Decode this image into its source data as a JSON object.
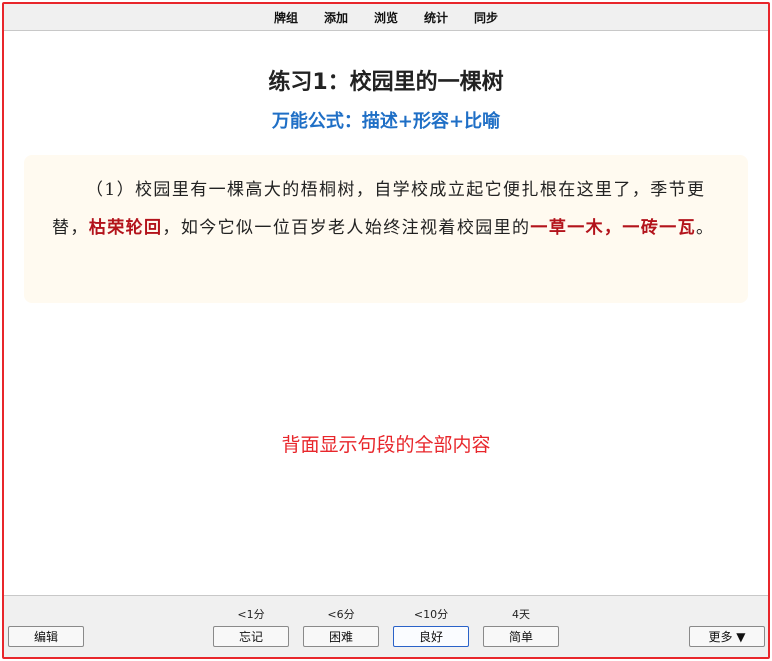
{
  "menu": {
    "decks": "牌组",
    "add": "添加",
    "browse": "浏览",
    "stats": "统计",
    "sync": "同步"
  },
  "card": {
    "title": "练习1：校园里的一棵树",
    "subtitle": "万能公式：描述+形容+比喻",
    "passage": {
      "p1": "（1）校园里有一棵高大的梧桐树，自学校成立起它便扎根在这里了，季节更替，",
      "h1": "枯荣轮回",
      "p2": "，如今它似一位百岁老人始终注视着校园里的",
      "h2": "一草一木，一砖一瓦",
      "p3": "。"
    },
    "note": "背面显示句段的全部内容"
  },
  "bottom": {
    "edit": "编辑",
    "more": "更多 ▼",
    "answers": [
      {
        "interval": "<1分",
        "label": "忘记"
      },
      {
        "interval": "<6分",
        "label": "困难"
      },
      {
        "interval": "<10分",
        "label": "良好"
      },
      {
        "interval": "4天",
        "label": "简单"
      }
    ]
  },
  "colors": {
    "frame": "#e8262b",
    "subtitle": "#1f6fc6",
    "highlight": "#b3131b",
    "passage_bg": "#fffaf0"
  }
}
